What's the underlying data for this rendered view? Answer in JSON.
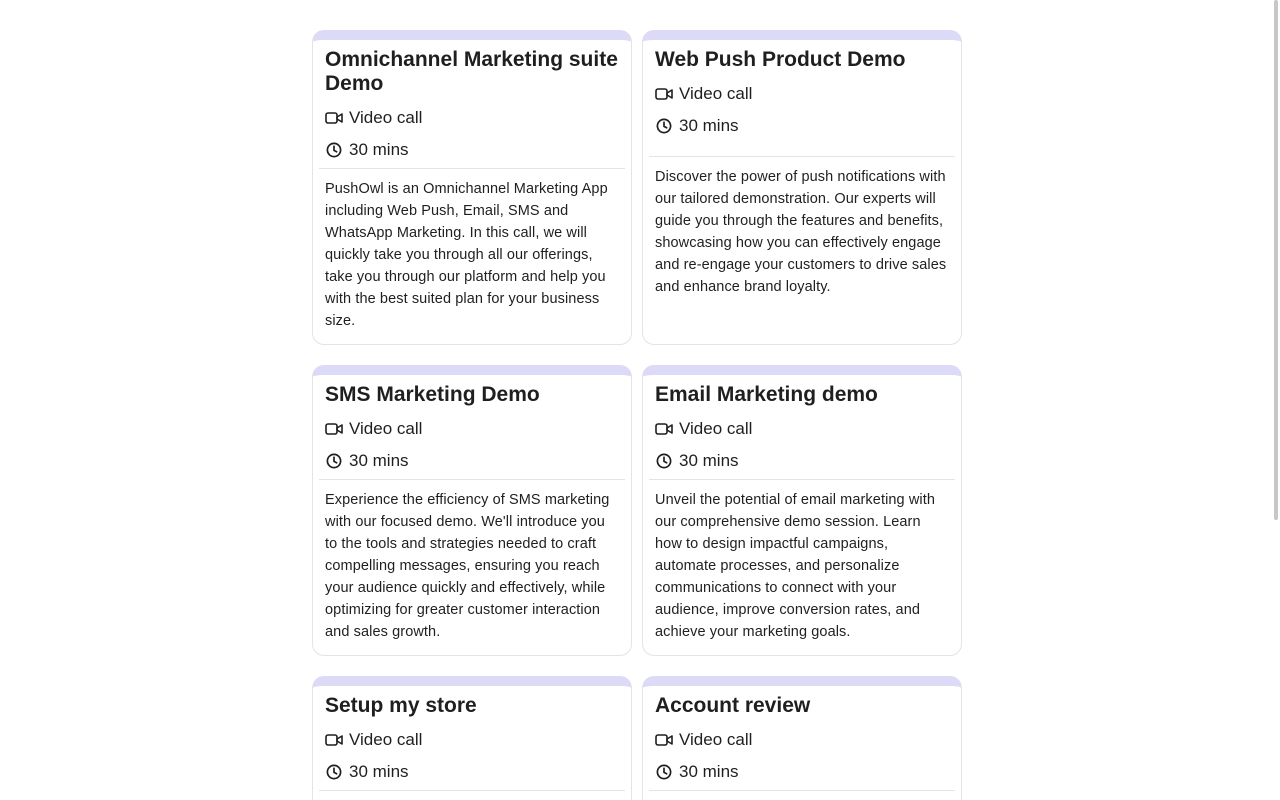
{
  "cards": [
    {
      "title": "Omnichannel Marketing suite Demo",
      "location": "Video call",
      "duration": "30 mins",
      "description": "PushOwl is an Omnichannel Marketing App including Web Push, Email, SMS and WhatsApp Marketing. In this call, we will quickly take you through all our offerings, take you through our platform and help you with the best suited plan for your business size."
    },
    {
      "title": "Web Push Product Demo",
      "location": "Video call",
      "duration": "30 mins",
      "description": "Discover the power of push notifications with our tailored demonstration. Our experts will guide you through the features and benefits, showcasing how you can effectively engage and re-engage your customers to drive sales and enhance brand loyalty."
    },
    {
      "title": "SMS Marketing Demo",
      "location": "Video call",
      "duration": "30 mins",
      "description": "Experience the efficiency of SMS marketing with our focused demo. We'll introduce you to the tools and strategies needed to craft compelling messages, ensuring you reach your audience quickly and effectively, while optimizing for greater customer interaction and sales growth."
    },
    {
      "title": "Email Marketing demo",
      "location": "Video call",
      "duration": "30 mins",
      "description": "Unveil the potential of email marketing with our comprehensive demo session. Learn how to design impactful campaigns, automate processes, and personalize communications to connect with your audience, improve conversion rates, and achieve your marketing goals."
    },
    {
      "title": "Setup my store",
      "location": "Video call",
      "duration": "30 mins",
      "description": ""
    },
    {
      "title": "Account review",
      "location": "Video call",
      "duration": "30 mins",
      "description": ""
    }
  ],
  "icons": {
    "location": "video-camera-icon",
    "duration": "clock-icon"
  },
  "colors": {
    "card_accent": "#dcdaf7",
    "card_border": "#e3e3e8",
    "text": "#1f1f1f"
  }
}
